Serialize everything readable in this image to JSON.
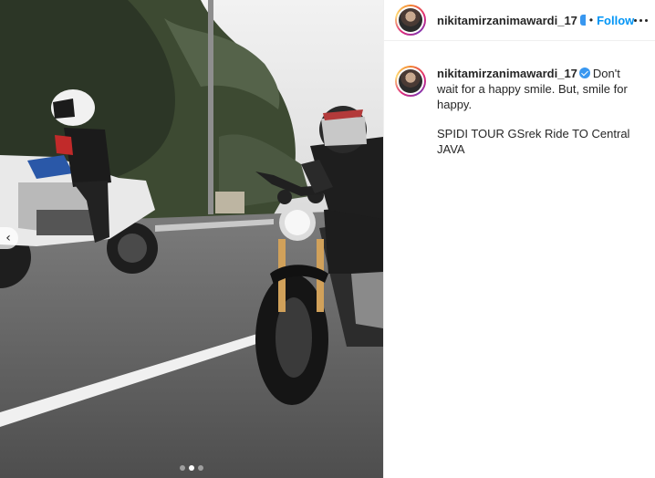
{
  "post": {
    "username": "nikitamirzanimawardi_17",
    "follow_label": "Follow",
    "separator": "•",
    "caption_text": "Don't wait for a happy smile. But, smile for happy.",
    "caption_text_2": "SPIDI TOUR GSrek Ride TO Central JAVA"
  },
  "carousel": {
    "slide_count": 3,
    "active_index": 1,
    "prev_arrow": "‹"
  },
  "colors": {
    "follow_blue": "#0095f6",
    "verified_blue": "#3897f0",
    "text": "#262626"
  },
  "icons": [
    "chevron-left-icon",
    "verified-badge-icon",
    "more-options-icon"
  ]
}
